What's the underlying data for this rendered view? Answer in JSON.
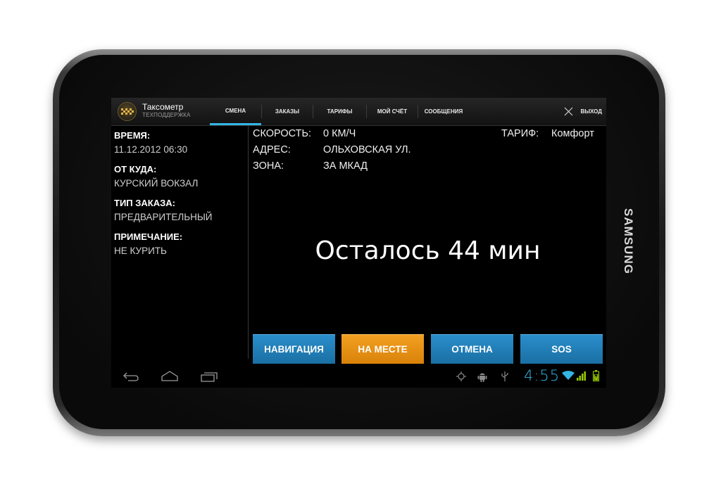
{
  "device": {
    "brand": "SAMSUNG"
  },
  "app": {
    "title": "Таксометр",
    "subtitle": "ТЕХПОДДЕРЖКА",
    "exit_label": "ВЫХОД"
  },
  "tabs": [
    {
      "label": "СМЕНА",
      "active": true
    },
    {
      "label": "ЗАКАЗЫ",
      "active": false
    },
    {
      "label": "ТАРИФЫ",
      "active": false
    },
    {
      "label": "МОЙ СЧЁТ",
      "active": false
    },
    {
      "label": "СООБЩЕНИЯ",
      "active": false
    }
  ],
  "order": {
    "time_label": "ВРЕМЯ:",
    "time_value": "11.12.2012 06:30",
    "from_label": "ОТ КУДА:",
    "from_value": "КУРСКИЙ ВОКЗАЛ",
    "type_label": "ТИП ЗАКАЗА:",
    "type_value": "ПРЕДВАРИТЕЛЬНЫЙ",
    "note_label": "ПРИМЕЧАНИЕ:",
    "note_value": "НЕ КУРИТЬ"
  },
  "status": {
    "speed_label": "СКОРОСТЬ:",
    "speed_value": "0 КМ/Ч",
    "address_label": "АДРЕС:",
    "address_value": "ОЛЬХОВСКАЯ УЛ.",
    "zone_label": "ЗОНА:",
    "zone_value": "ЗА МКАД",
    "tariff_label": "ТАРИФ:",
    "tariff_value": "Комфорт",
    "remaining": "Осталось 44 мин"
  },
  "buttons": {
    "navigation": "НАВИГАЦИЯ",
    "arrived": "НА МЕСТЕ",
    "cancel": "ОТМЕНА",
    "sos": "SOS"
  },
  "system": {
    "clock": "4:55"
  },
  "colors": {
    "accent": "#33b5e5",
    "button_blue": "#1f7fb8",
    "button_orange": "#e8900f"
  }
}
